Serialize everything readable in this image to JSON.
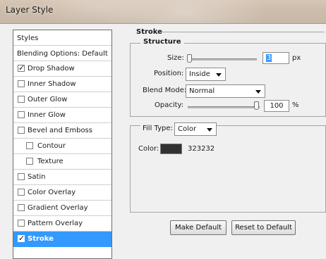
{
  "window": {
    "title": "Layer Style"
  },
  "styles_list": {
    "header": "Styles",
    "blending": "Blending Options: Default",
    "items": [
      {
        "label": "Drop Shadow",
        "checked": true
      },
      {
        "label": "Inner Shadow",
        "checked": false
      },
      {
        "label": "Outer Glow",
        "checked": false
      },
      {
        "label": "Inner Glow",
        "checked": false
      },
      {
        "label": "Bevel and Emboss",
        "checked": false
      },
      {
        "label": "Contour",
        "checked": false
      },
      {
        "label": "Texture",
        "checked": false
      },
      {
        "label": "Satin",
        "checked": false
      },
      {
        "label": "Color Overlay",
        "checked": false
      },
      {
        "label": "Gradient Overlay",
        "checked": false
      },
      {
        "label": "Pattern Overlay",
        "checked": false
      },
      {
        "label": "Stroke",
        "checked": true,
        "selected": true
      }
    ]
  },
  "stroke": {
    "section_title": "Stroke",
    "structure_title": "Structure",
    "size": {
      "label": "Size:",
      "value": "3",
      "unit": "px"
    },
    "position": {
      "label": "Position:",
      "value": "Inside"
    },
    "blend_mode": {
      "label": "Blend Mode:",
      "value": "Normal"
    },
    "opacity": {
      "label": "Opacity:",
      "value": "100",
      "unit": "%"
    },
    "fill_type": {
      "label": "Fill Type:",
      "value": "Color"
    },
    "color": {
      "label": "Color:",
      "hex": "#323232",
      "value_text": "323232"
    }
  },
  "buttons": {
    "make_default": "Make Default",
    "reset_default": "Reset to Default"
  },
  "colors": {
    "selected_row": "#3399ff",
    "swatch": "#323232"
  }
}
